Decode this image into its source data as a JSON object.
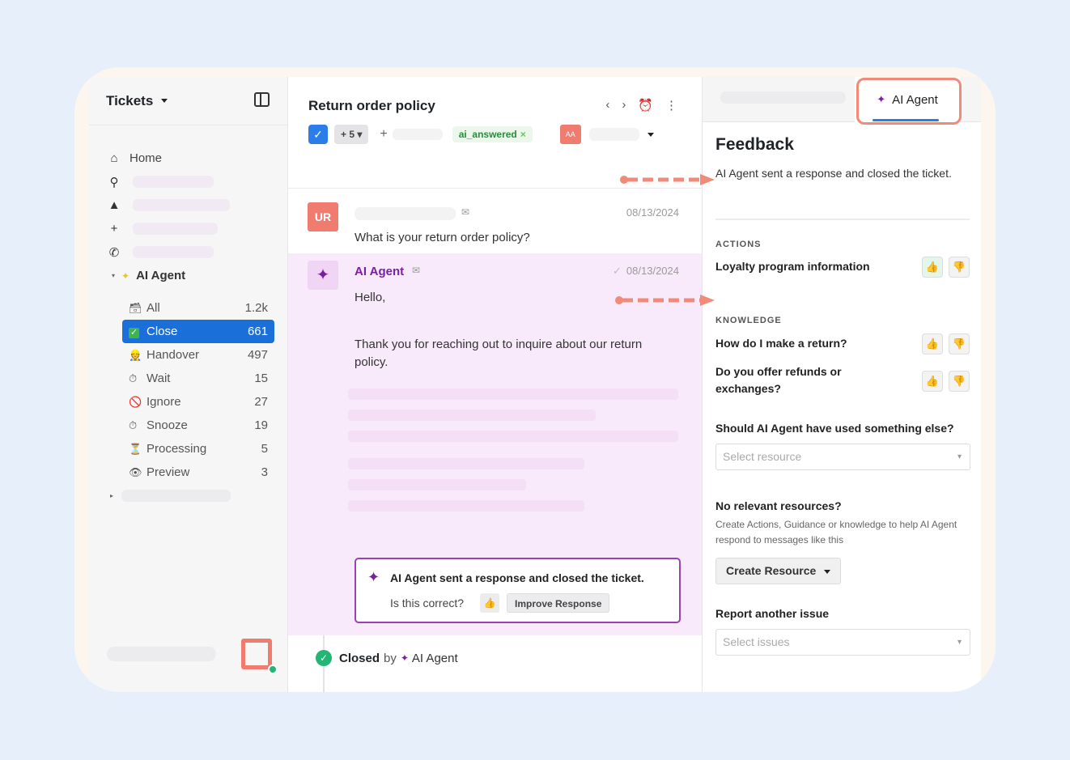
{
  "sidebar": {
    "title": "Tickets",
    "home_label": "Home",
    "group_label": "AI Agent",
    "items": [
      {
        "emoji": "🗃",
        "label": "All",
        "count": "1.2k"
      },
      {
        "emoji": "✓",
        "label": "Close",
        "count": "661"
      },
      {
        "emoji": "👷",
        "label": "Handover",
        "count": "497"
      },
      {
        "emoji": "⏱",
        "label": "Wait",
        "count": "15"
      },
      {
        "emoji": "🚫",
        "label": "Ignore",
        "count": "27"
      },
      {
        "emoji": "⏱",
        "label": "Snooze",
        "count": "19"
      },
      {
        "emoji": "⏳",
        "label": "Processing",
        "count": "5"
      },
      {
        "emoji": "👁",
        "label": "Preview",
        "count": "3"
      }
    ]
  },
  "ticket": {
    "title": "Return order policy",
    "more_tags": "+ 5",
    "tag": "ai_answered",
    "assignee_initials": "AA"
  },
  "customer_msg": {
    "avatar": "UR",
    "date": "08/13/2024",
    "text": "What is your return order policy?"
  },
  "ai_msg": {
    "name": "AI Agent",
    "date": "08/13/2024",
    "greeting": "Hello,",
    "body": "Thank you for reaching out to inquire about our return policy."
  },
  "notice": {
    "title": "AI Agent sent a response and closed the ticket.",
    "question": "Is this correct?",
    "improve": "Improve Response"
  },
  "closed": {
    "prefix": "Closed",
    "by": "by",
    "agent": "AI Agent"
  },
  "right": {
    "tab": "AI Agent",
    "feedback_title": "Feedback",
    "feedback_desc": "AI Agent sent a response and closed the ticket.",
    "actions_label": "ACTIONS",
    "action_item": "Loyalty program information",
    "knowledge_label": "KNOWLEDGE",
    "knowledge_1": "How do I make a return?",
    "knowledge_2": "Do you offer refunds or exchanges?",
    "q_else": "Should AI Agent have used something else?",
    "select_resource": "Select resource",
    "q_none": "No relevant resources?",
    "hint": "Create Actions, Guidance or knowledge to help AI Agent respond to messages like this",
    "create_btn": "Create Resource",
    "q_report": "Report another issue",
    "select_issues": "Select issues"
  },
  "colors": {
    "accent": "#1b6fd8",
    "ai_purple": "#7a1fa2",
    "highlight": "#f28a7a",
    "success": "#23b573"
  }
}
